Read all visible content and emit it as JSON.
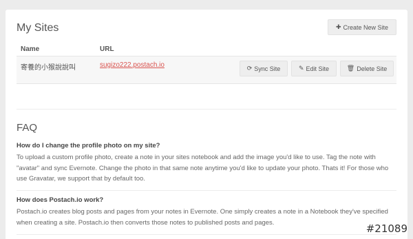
{
  "sites": {
    "title": "My Sites",
    "create_button": {
      "icon": "plus-icon",
      "label": "Create New Site"
    },
    "columns": {
      "name": "Name",
      "url": "URL"
    },
    "rows": [
      {
        "name": "寄養的小猴說說叫",
        "url": "sugizo222.postach.io",
        "actions": {
          "sync": {
            "icon": "refresh-icon",
            "label": "Sync Site"
          },
          "edit": {
            "icon": "pencil-icon",
            "label": "Edit Site"
          },
          "delete": {
            "icon": "trash-icon",
            "label": "Delete Site"
          }
        }
      }
    ]
  },
  "faq": {
    "title": "FAQ",
    "items": [
      {
        "question": "How do I change the profile photo on my site?",
        "answer": "To upload a custom profile photo, create a note in your sites notebook and add the image you'd like to use. Tag the note with \"avatar\" and sync Evernote. Change the photo in that same note anytime you'd like to update your photo. Thats it! For those who use Gravatar, we support that by default too."
      },
      {
        "question": "How does Postach.io work?",
        "answer": "Postach.io creates blog posts and pages from your notes in Evernote. One simply creates a note in a Notebook they've specified when creating a site. Postach.io then converts those notes to published posts and pages."
      }
    ]
  },
  "badge": "#21089",
  "colors": {
    "link": "#d9534f",
    "button_bg": "#eeeeee",
    "panel_bg": "#ffffff",
    "page_bg": "#ececec"
  }
}
